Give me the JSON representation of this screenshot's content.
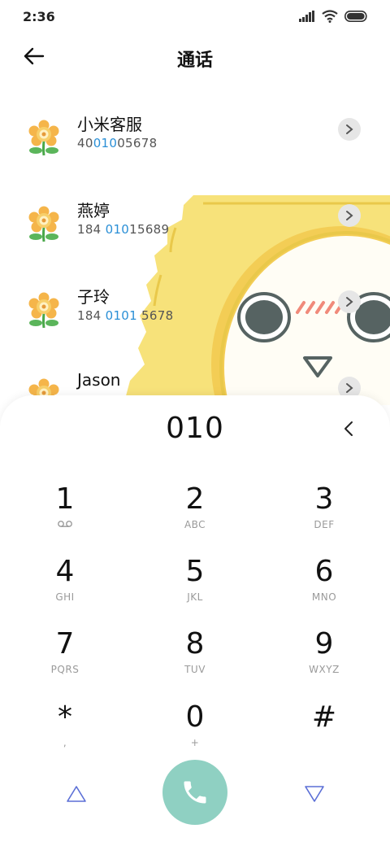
{
  "status": {
    "time": "2:36"
  },
  "header": {
    "title": "通话"
  },
  "contacts": [
    {
      "name": "小米客服",
      "number_pre": "40",
      "number_hl": "010",
      "number_post": "05678"
    },
    {
      "name": "燕婷",
      "number_pre": "184 ",
      "number_hl": "010",
      "number_post": "15689"
    },
    {
      "name": "子玲",
      "number_pre": "184 ",
      "number_hl": "0101",
      "number_post": " 5678"
    },
    {
      "name": "Jason",
      "number_pre": "",
      "number_hl": "",
      "number_post": ""
    }
  ],
  "dialer": {
    "display": "010",
    "keys": [
      {
        "digit": "1",
        "sub": ""
      },
      {
        "digit": "2",
        "sub": "ABC"
      },
      {
        "digit": "3",
        "sub": "DEF"
      },
      {
        "digit": "4",
        "sub": "GHI"
      },
      {
        "digit": "5",
        "sub": "JKL"
      },
      {
        "digit": "6",
        "sub": "MNO"
      },
      {
        "digit": "7",
        "sub": "PQRS"
      },
      {
        "digit": "8",
        "sub": "TUV"
      },
      {
        "digit": "9",
        "sub": "WXYZ"
      },
      {
        "digit": "*",
        "sub": ","
      },
      {
        "digit": "0",
        "sub": "+"
      },
      {
        "digit": "#",
        "sub": ""
      }
    ]
  },
  "colors": {
    "accent": "#2a8fd6",
    "call_button": "#8fd0c2",
    "nav_triangle": "#5b6fd6",
    "mascot_yellow": "#f7e27a"
  },
  "icons": {
    "back": "arrow-left-icon",
    "detail": "chevron-right-icon",
    "backspace": "chevron-left-icon",
    "voicemail": "voicemail-icon",
    "call": "phone-icon",
    "avatar": "flower-icon"
  }
}
